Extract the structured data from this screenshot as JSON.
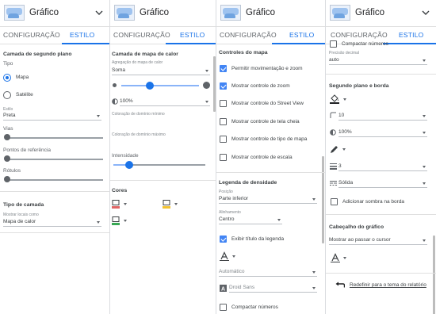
{
  "header": {
    "title": "Gráfico",
    "tabs": [
      "CONFIGURAÇÃO",
      "ESTILO"
    ]
  },
  "colors": {
    "accent": "#1a73e8",
    "checkbox": "#4285f4"
  },
  "panel1": {
    "section_title": "Camada de segundo plano",
    "type_label": "Tipo",
    "radio_options": [
      "Mapa",
      "Satélite"
    ],
    "style_label": "Estilo",
    "style_value": "Preta",
    "sliders": [
      "Vias",
      "Pontos de referência",
      "Rótulos"
    ],
    "layer_type_title": "Tipo de camada",
    "show_locations_label": "Mostrar locais como",
    "show_locations_value": "Mapa de calor"
  },
  "panel2": {
    "section_title": "Camada de mapa de calor",
    "aggregation_label": "Agregação do mapa de calor",
    "aggregation_value": "Soma",
    "opacity_value": "100%",
    "min_color_label": "Coloração de domínio mínimo",
    "max_color_label": "Coloração de domínio máximo",
    "intensity_label": "Intensidade",
    "colors_title": "Cores"
  },
  "panel3": {
    "section_title": "Controles do mapa",
    "controls": [
      {
        "label": "Permitir movimentação e zoom",
        "checked": true
      },
      {
        "label": "Mostrar controle de zoom",
        "checked": true
      },
      {
        "label": "Mostrar controle do Street View",
        "checked": false
      },
      {
        "label": "Mostrar controle de tela cheia",
        "checked": false
      },
      {
        "label": "Mostrar controle de tipo de mapa",
        "checked": false
      },
      {
        "label": "Mostrar controle de escala",
        "checked": false
      }
    ],
    "legend_title": "Legenda de densidade",
    "position_label": "Posição",
    "position_value": "Parte inferior",
    "alignment_label": "Alinhamento",
    "alignment_value": "Centro",
    "show_legend_title": "Exibir título da legenda",
    "text_size_value": "Automático",
    "font_value": "Droid Sans",
    "compact_numbers": "Compactar números"
  },
  "panel4": {
    "compact_numbers": "Compactar números",
    "decimal_label": "Precisão decimal",
    "decimal_value": "auto",
    "background_title": "Segundo plano e borda",
    "border_radius_value": "10",
    "opacity_value": "100%",
    "border_weight_value": "3",
    "border_style_value": "Sólida",
    "add_shadow_label": "Adicionar sombra na borda",
    "chart_header_title": "Cabeçalho do gráfico",
    "show_on_hover_value": "Mostrar ao passar o cursor",
    "reset_link": "Redefinir para o tema do relatório"
  }
}
